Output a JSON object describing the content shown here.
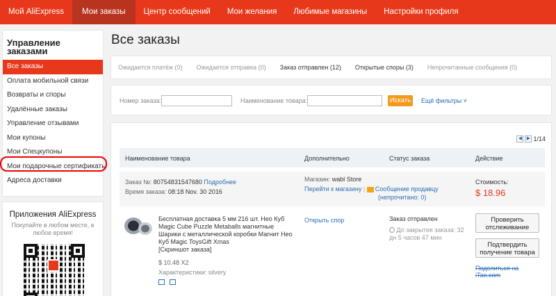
{
  "topnav": {
    "items": [
      {
        "label": "Мой AliExpress"
      },
      {
        "label": "Мои заказы"
      },
      {
        "label": "Центр сообщений"
      },
      {
        "label": "Мои желания"
      },
      {
        "label": "Любимые магазины"
      },
      {
        "label": "Настройки профиля"
      }
    ],
    "active_index": 1
  },
  "sidebar": {
    "title": "Управление заказами",
    "items": [
      {
        "label": "Все заказы"
      },
      {
        "label": "Оплата мобильной связи"
      },
      {
        "label": "Возвраты и споры"
      },
      {
        "label": "Удалённые заказы"
      },
      {
        "label": "Управление отзывами"
      },
      {
        "label": "Мои купоны"
      },
      {
        "label": "Мои Спецкупоны"
      },
      {
        "label": "Мои подарочные сертификаты"
      },
      {
        "label": "Адреса доставки"
      }
    ],
    "active_index": 0,
    "highlighted_index": 7
  },
  "app_promo": {
    "title": "Приложения AliExpress",
    "subtitle": "Покупайте в любом месте, в любое время!"
  },
  "main": {
    "title": "Все заказы",
    "tabs": [
      {
        "label": "Ожидается платёж (0)"
      },
      {
        "label": "Ожидается отправка (0)"
      },
      {
        "label": "Заказ отправлен (12)"
      },
      {
        "label": "Открытые споры (3)"
      },
      {
        "label": "Непрочитанные сообщения (0)"
      }
    ]
  },
  "filter": {
    "order_number_label": "Номер заказа:",
    "order_number_value": "",
    "product_name_label": "Наименование товара:",
    "product_name_value": "",
    "search_button": "Искать",
    "more_filters": "Ещё фильтры"
  },
  "pager": {
    "text": "1/14"
  },
  "table": {
    "headers": [
      "Наименование товара",
      "Дополнительно",
      "Статус заказа",
      "Действие"
    ]
  },
  "order": {
    "number_label": "Заказ №:",
    "number": "80754831547680",
    "details_link": "Подробнее",
    "time_label": "Время заказа:",
    "time": "08:18 Nov. 30 2016",
    "shop_label": "Магазин:",
    "shop": "wabl Store",
    "go_to_shop": "Перейти к магазину",
    "message_seller": "Сообщение продавцу",
    "unread": "(непрочитано: 0)",
    "cost_label": "Стоимость:",
    "cost": "$ 18.96"
  },
  "item": {
    "title": "Бесплатная доставка 5 мм 216 шт. Нео Куб Magic Cube Puzzle Metaballs магнитные Шарики с металлической коробки Магнит Нео Куб Magic ToysGift Xmas",
    "screenshot": "[Скриншот заказа]",
    "price": "$ 10.48 X2",
    "characteristics": "Характеристики: silvery",
    "open_dispute": "Открыть спор",
    "status": "Заказ отправлен",
    "close_info": "До закрытия заказа: 32 дн 5 часов 47 мин",
    "btn_track": "Проверить отслеживание",
    "btn_confirm": "Подтвердить получение товара",
    "share": "Поделиться на iTao.com"
  }
}
